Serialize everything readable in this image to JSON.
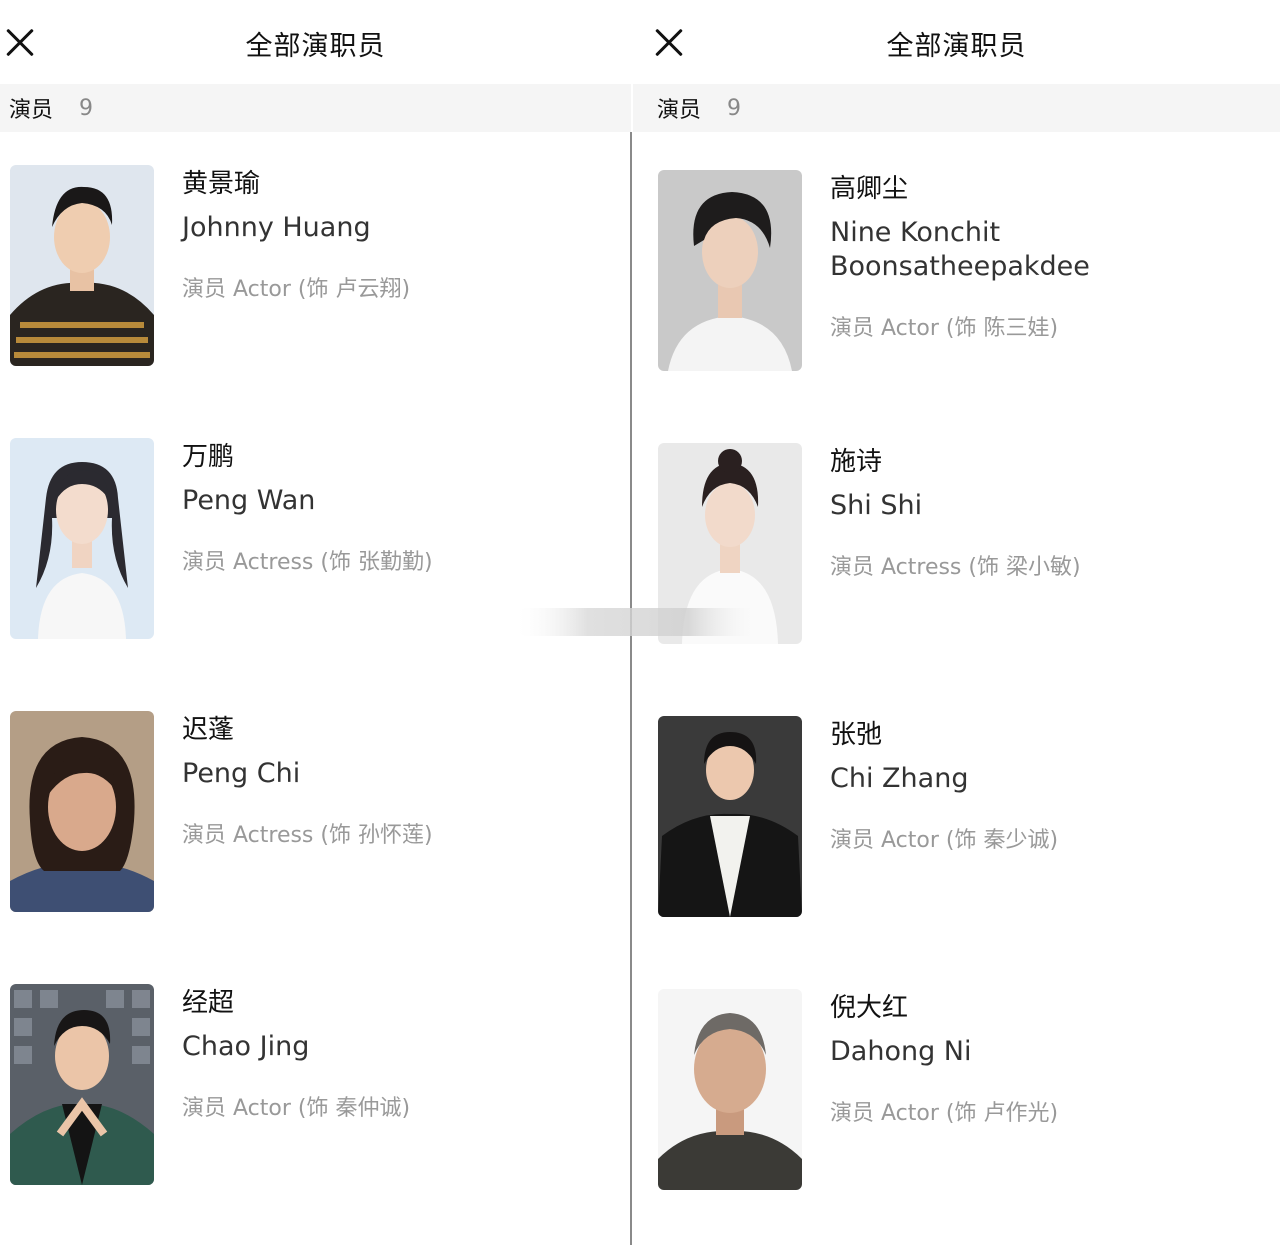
{
  "panels": [
    {
      "title": "全部演职员",
      "subbar": {
        "label": "演员",
        "count": "9"
      },
      "cast": [
        {
          "cn": "黄景瑜",
          "en": "Johnny Huang",
          "role": "演员 Actor (饰 卢云翔)"
        },
        {
          "cn": "万鹏",
          "en": "Peng Wan",
          "role": "演员 Actress (饰 张勤勤)"
        },
        {
          "cn": "迟蓬",
          "en": "Peng Chi",
          "role": "演员 Actress (饰 孙怀莲)"
        },
        {
          "cn": "经超",
          "en": "Chao Jing",
          "role": "演员 Actor (饰 秦仲诚)"
        }
      ]
    },
    {
      "title": "全部演职员",
      "subbar": {
        "label": "演员",
        "count": "9"
      },
      "cast": [
        {
          "cn": "高卿尘",
          "en": "Nine Konchit Boonsatheepakdee",
          "role": "演员 Actor (饰 陈三娃)"
        },
        {
          "cn": "施诗",
          "en": "Shi Shi",
          "role": "演员 Actress (饰 梁小敏)"
        },
        {
          "cn": "张弛",
          "en": "Chi Zhang",
          "role": "演员 Actor (饰 秦少诚)"
        },
        {
          "cn": "倪大红",
          "en": "Dahong Ni",
          "role": "演员 Actor (饰 卢作光)"
        }
      ]
    }
  ]
}
